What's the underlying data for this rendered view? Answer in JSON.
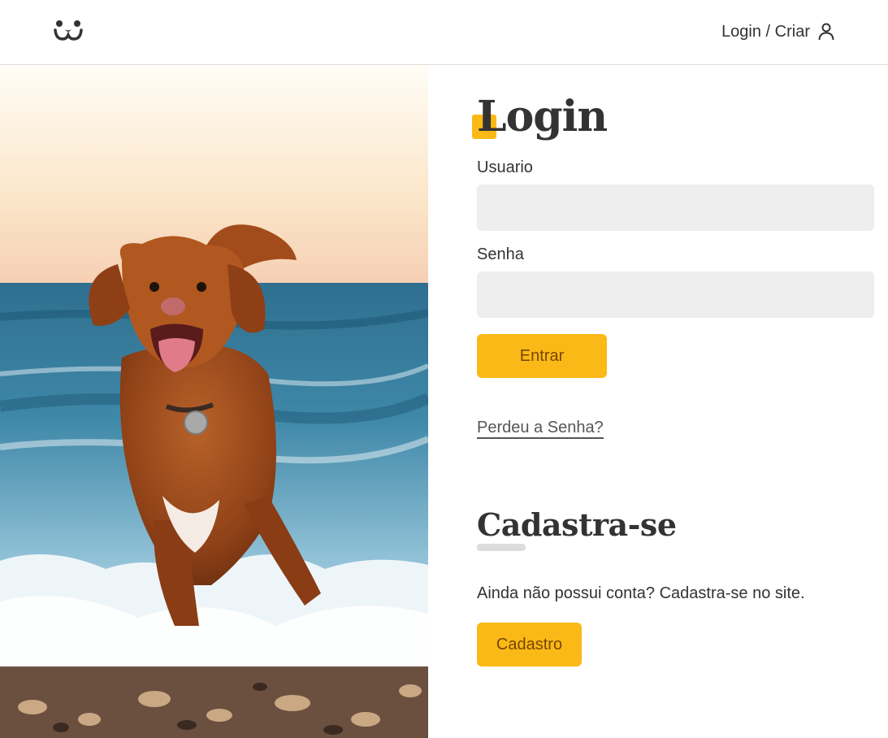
{
  "header": {
    "logo_icon": "dog-face-icon",
    "login_link_label": "Login / Criar",
    "user_icon": "user-icon"
  },
  "photo": {
    "subject": "dog-running-on-beach"
  },
  "login": {
    "title": "Login",
    "username_label": "Usuario",
    "username_value": "",
    "password_label": "Senha",
    "password_value": "",
    "submit_label": "Entrar",
    "lost_password_label": "Perdeu a Senha?"
  },
  "signup": {
    "title": "Cadastra-se",
    "text": "Ainda não possui conta? Cadastra-se no site.",
    "button_label": "Cadastro"
  },
  "colors": {
    "accent": "#fbb917",
    "button_text": "#764701",
    "input_bg": "#eeeeee",
    "text": "#333333"
  }
}
